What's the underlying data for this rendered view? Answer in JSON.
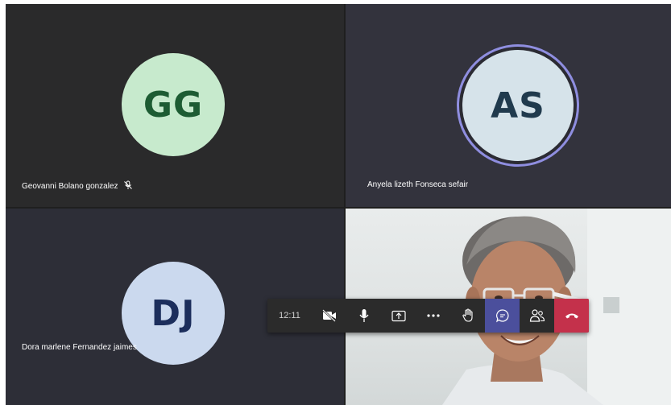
{
  "participants": [
    {
      "initials": "GG",
      "name": "Geovanni Bolano gonzalez",
      "muted": true,
      "avatar_bg": "#c7eacd",
      "avatar_fg": "#1d5c33"
    },
    {
      "initials": "AS",
      "name": "Anyela lizeth Fonseca sefair",
      "speaking": true,
      "avatar_bg": "#d6e3ea",
      "avatar_fg": "#203a4d",
      "ring": "#8f8ee0"
    },
    {
      "initials": "DJ",
      "name": "Dora marlene Fernandez jaimes",
      "avatar_bg": "#cbd9ee",
      "avatar_fg": "#1c2e5c"
    }
  ],
  "toolbar": {
    "time": "12:11",
    "buttons": [
      "camera-off-icon",
      "microphone-icon",
      "share-screen-icon",
      "more-options-icon",
      "raise-hand-icon",
      "chat-icon",
      "participants-icon",
      "hang-up-icon"
    ],
    "chat_active_color": "#4b4f9c",
    "hangup_color": "#c4314b"
  }
}
